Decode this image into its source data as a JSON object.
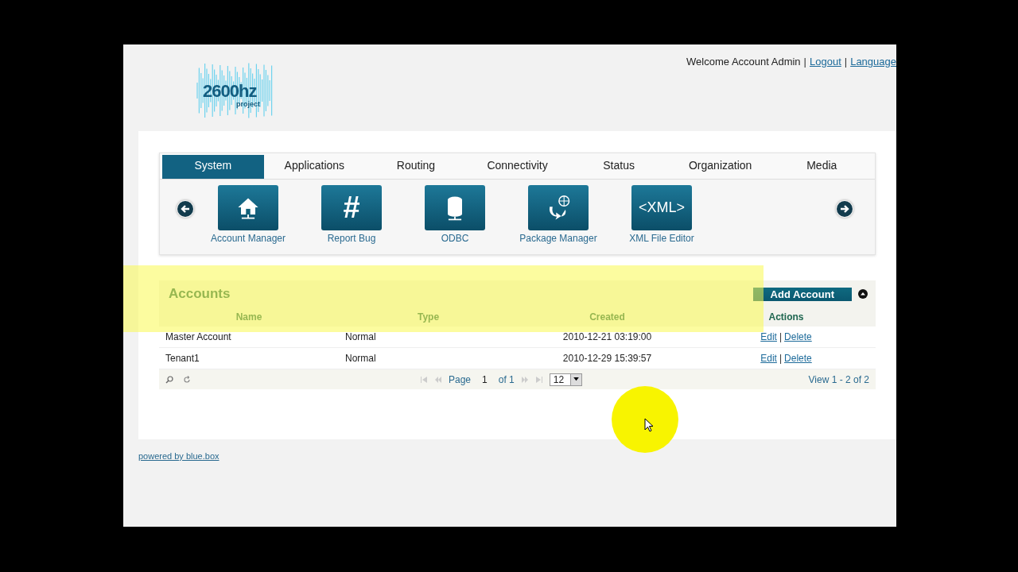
{
  "header": {
    "logo": {
      "text": "2600hz",
      "subtext": "project"
    },
    "welcome": "Welcome Account Admin",
    "links": [
      "Logout",
      "Language"
    ],
    "separator": "|"
  },
  "tabs": [
    {
      "label": "System",
      "selected": true
    },
    {
      "label": "Applications",
      "selected": false
    },
    {
      "label": "Routing",
      "selected": false
    },
    {
      "label": "Connectivity",
      "selected": false
    },
    {
      "label": "Status",
      "selected": false
    },
    {
      "label": "Organization",
      "selected": false
    },
    {
      "label": "Media",
      "selected": false
    }
  ],
  "apps": [
    {
      "kind": "house",
      "label": "Account Manager"
    },
    {
      "kind": "hash",
      "label": "Report Bug",
      "glyph": "#"
    },
    {
      "kind": "database",
      "label": "ODBC"
    },
    {
      "kind": "package",
      "label": "Package Manager"
    },
    {
      "kind": "xml",
      "label": "XML File Editor",
      "glyph": "<XML>"
    }
  ],
  "accounts": {
    "title": "Accounts",
    "add_button": "Add Account",
    "columns": [
      "Name",
      "Type",
      "Created",
      "Actions"
    ],
    "action_separator": "|",
    "rows": [
      {
        "name": "Master Account",
        "type": "Normal",
        "created": "2010-12-21 03:19:00",
        "actions": [
          "Edit",
          "Delete"
        ]
      },
      {
        "name": "Tenant1",
        "type": "Normal",
        "created": "2010-12-29 15:39:57",
        "actions": [
          "Edit",
          "Delete"
        ]
      }
    ],
    "pager": {
      "page_label": "Page",
      "page": "1",
      "of": "of 1",
      "page_size": "12",
      "view": "View 1 - 2 of 2"
    }
  },
  "footer": {
    "link": "powered by blue.box"
  }
}
